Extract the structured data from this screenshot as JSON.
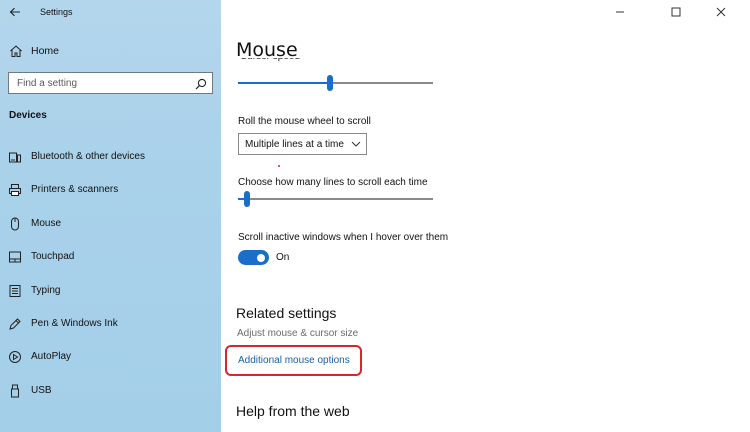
{
  "window": {
    "title": "Settings",
    "controls": [
      "minimize",
      "maximize",
      "close"
    ]
  },
  "sidebar": {
    "home_label": "Home",
    "search_placeholder": "Find a setting",
    "section_title": "Devices",
    "items": [
      {
        "label": "Bluetooth & other devices",
        "icon": "bluetooth-devices-icon"
      },
      {
        "label": "Printers & scanners",
        "icon": "printer-icon"
      },
      {
        "label": "Mouse",
        "icon": "mouse-icon"
      },
      {
        "label": "Touchpad",
        "icon": "touchpad-icon"
      },
      {
        "label": "Typing",
        "icon": "keyboard-icon"
      },
      {
        "label": "Pen & Windows Ink",
        "icon": "pen-icon"
      },
      {
        "label": "AutoPlay",
        "icon": "autoplay-icon"
      },
      {
        "label": "USB",
        "icon": "usb-icon"
      }
    ]
  },
  "main": {
    "page_title": "Mouse",
    "cursor_speed": {
      "label": "Cursor speed",
      "value_fraction": 0.47
    },
    "wheel_scroll": {
      "label": "Roll the mouse wheel to scroll",
      "selected": "Multiple lines at a time"
    },
    "lines_to_scroll": {
      "label": "Choose how many lines to scroll each time",
      "value_fraction": 0.03
    },
    "inactive_scroll": {
      "label": "Scroll inactive windows when I hover over them",
      "state_label": "On",
      "enabled": true
    },
    "related": {
      "title": "Related settings",
      "adjust_link": "Adjust mouse & cursor size",
      "additional_link": "Additional mouse options"
    },
    "help_title": "Help from the web"
  },
  "colors": {
    "accent": "#1a6dc8",
    "highlight": "#d8262a",
    "sidebar_bg": "#aad2ea",
    "link": "#1a5fa8"
  }
}
